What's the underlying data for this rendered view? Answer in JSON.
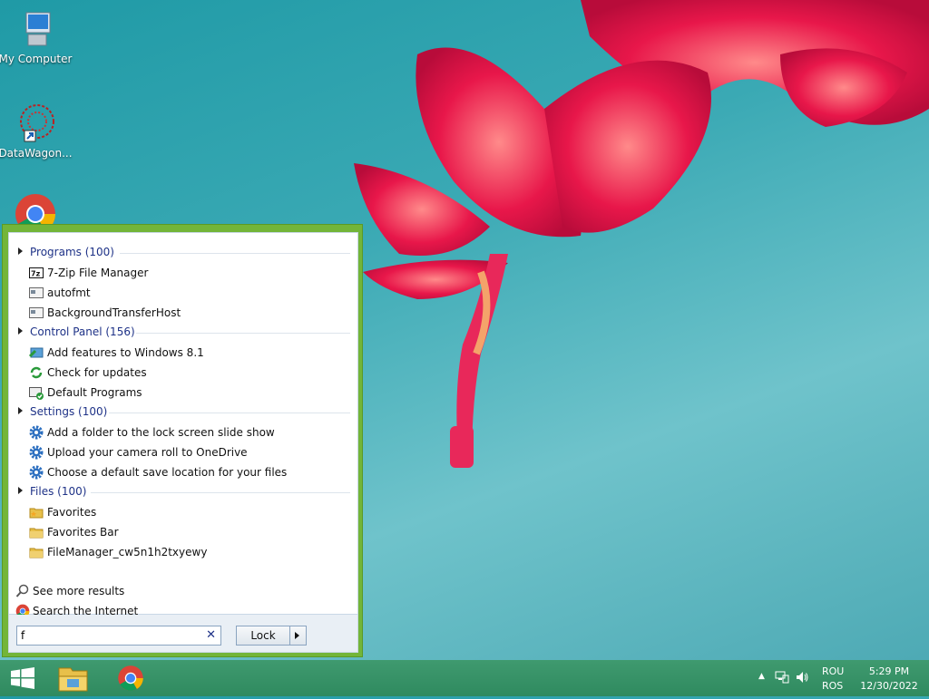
{
  "desktop": {
    "icons": [
      {
        "label": "My Computer",
        "icon": "computer-icon"
      },
      {
        "label": "DataWagon...",
        "icon": "datawagon-icon"
      },
      {
        "label": "",
        "icon": "chrome-icon"
      }
    ]
  },
  "start_menu": {
    "groups": [
      {
        "header": "Programs (100)",
        "items": [
          {
            "label": "7-Zip File Manager",
            "icon": "7zip-icon"
          },
          {
            "label": "autofmt",
            "icon": "app-window-icon"
          },
          {
            "label": "BackgroundTransferHost",
            "icon": "app-window-icon"
          }
        ]
      },
      {
        "header": "Control Panel (156)",
        "items": [
          {
            "label": "Add features to Windows 8.1",
            "icon": "add-features-icon"
          },
          {
            "label": "Check for updates",
            "icon": "windows-update-icon"
          },
          {
            "label": "Default Programs",
            "icon": "default-programs-icon"
          }
        ]
      },
      {
        "header": "Settings (100)",
        "items": [
          {
            "label": "Add a folder to the lock screen slide show",
            "icon": "gear-icon"
          },
          {
            "label": "Upload your camera roll to OneDrive",
            "icon": "gear-icon"
          },
          {
            "label": "Choose a default save location for your files",
            "icon": "gear-icon"
          }
        ]
      },
      {
        "header": "Files (100)",
        "items": [
          {
            "label": "Favorites",
            "icon": "folder-star-icon"
          },
          {
            "label": "Favorites Bar",
            "icon": "folder-icon"
          },
          {
            "label": "FileManager_cw5n1h2txyewy",
            "icon": "folder-icon"
          }
        ]
      }
    ],
    "see_more": "See more results",
    "search_internet": "Search the Internet",
    "search": {
      "value": "f",
      "clear_glyph": "✕"
    },
    "lock_button": "Lock"
  },
  "taskbar": {
    "buttons": [
      "start-button",
      "file-explorer-button",
      "chrome-button"
    ],
    "tray": {
      "lang_top": "ROU",
      "lang_bottom": "ROS",
      "time": "5:29 PM",
      "date": "12/30/2022"
    }
  },
  "colors": {
    "menu_border": "#73b539",
    "group_header": "#1e3287",
    "taskbar": "#3a9569"
  }
}
